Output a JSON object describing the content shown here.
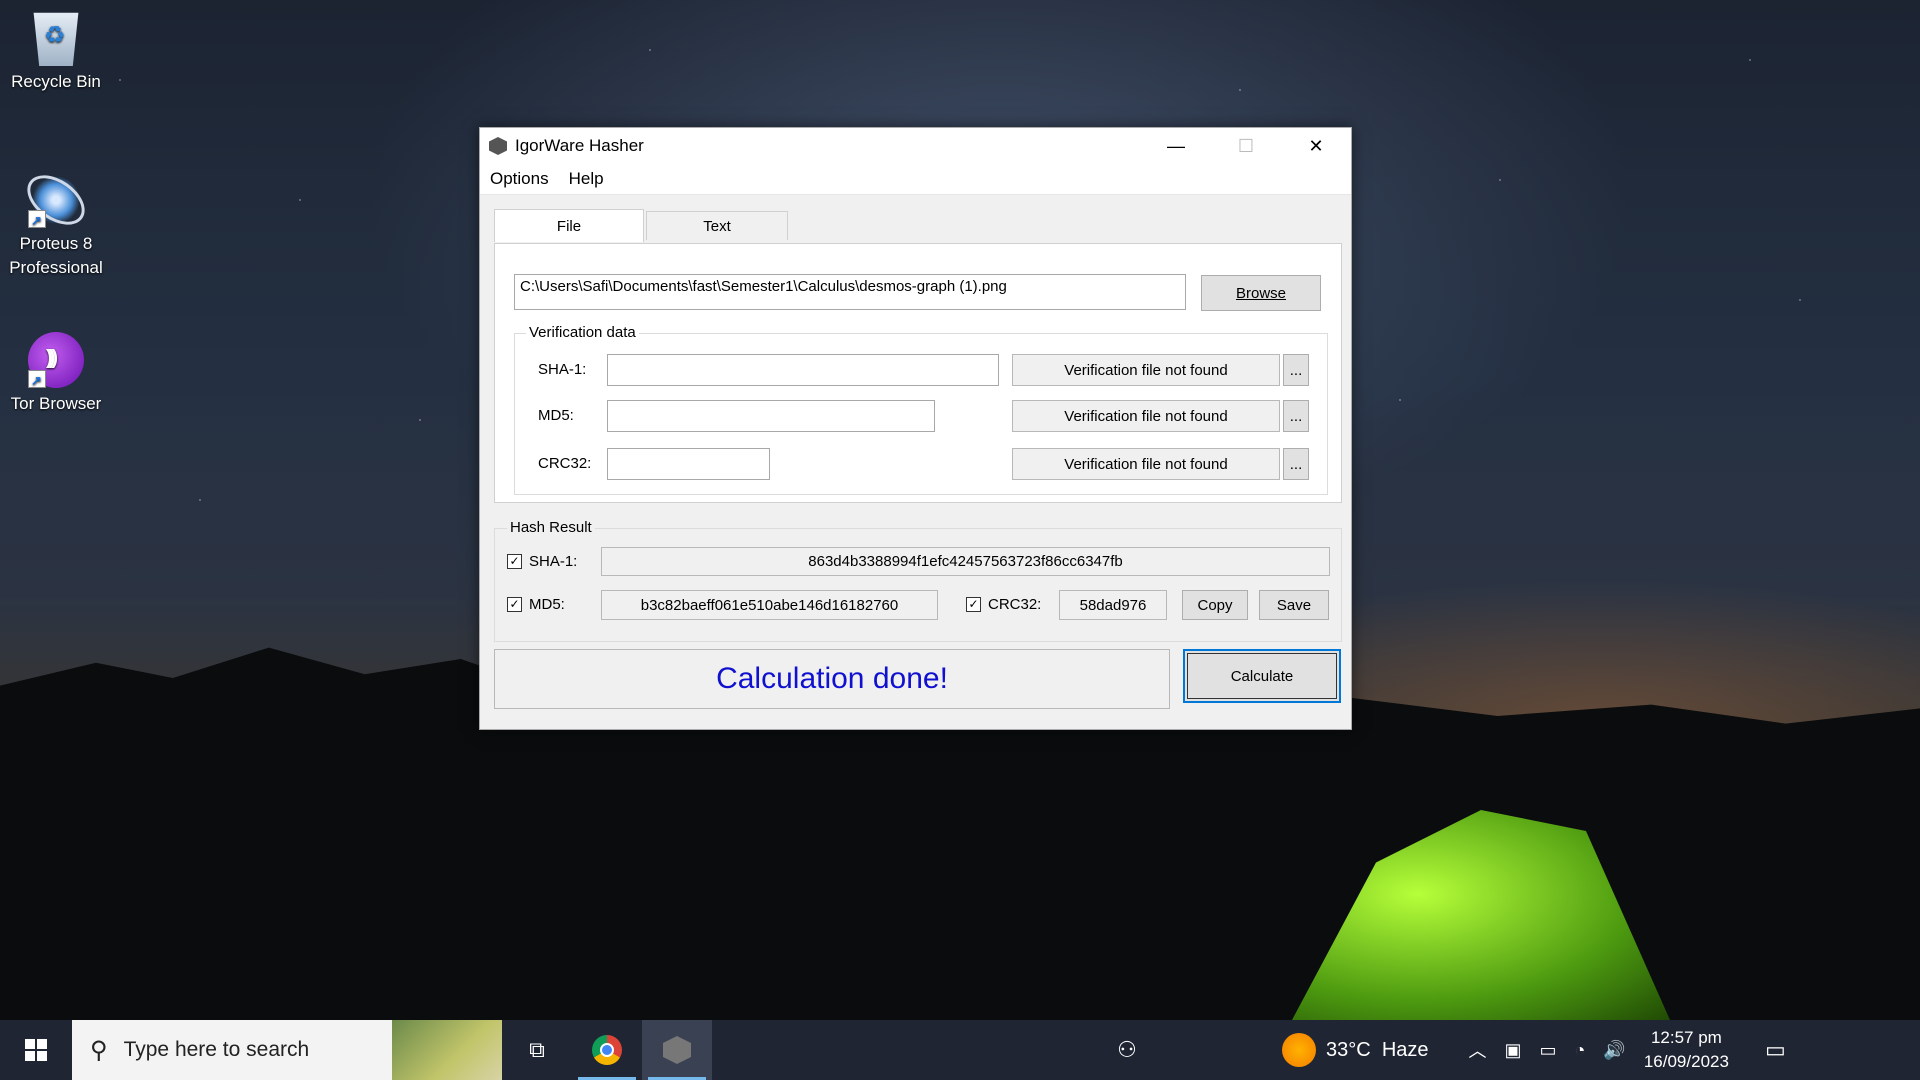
{
  "desktop": {
    "icons": [
      {
        "label": "Recycle Bin"
      },
      {
        "label": "Proteus 8 Professional"
      },
      {
        "label": "Tor Browser"
      }
    ]
  },
  "window": {
    "title": "IgorWare Hasher",
    "menu": [
      "Options",
      "Help"
    ],
    "tabs": [
      "File",
      "Text"
    ],
    "active_tab": "File",
    "file_path": "C:\\Users\\Safi\\Documents\\fast\\Semester1\\Calculus\\desmos-graph (1).png",
    "browse_label": "Browse",
    "verification": {
      "group_label": "Verification data",
      "rows": [
        {
          "label": "SHA-1:",
          "value": "",
          "status": "Verification file not found",
          "more": "..."
        },
        {
          "label": "MD5:",
          "value": "",
          "status": "Verification file not found",
          "more": "..."
        },
        {
          "label": "CRC32:",
          "value": "",
          "status": "Verification file not found",
          "more": "..."
        }
      ]
    },
    "hash_result": {
      "group_label": "Hash Result",
      "sha1_label": "SHA-1:",
      "sha1_value": "863d4b3388994f1efc42457563723f86cc6347fb",
      "sha1_checked": true,
      "md5_label": "MD5:",
      "md5_value": "b3c82baeff061e510abe146d16182760",
      "md5_checked": true,
      "crc32_label": "CRC32:",
      "crc32_value": "58dad976",
      "crc32_checked": true,
      "copy_label": "Copy",
      "save_label": "Save"
    },
    "status_text": "Calculation done!",
    "calculate_label": "Calculate",
    "status_color": "#1010d0"
  },
  "taskbar": {
    "search_placeholder": "Type here to search",
    "weather": {
      "temp": "33°C",
      "condition": "Haze"
    },
    "time": "12:57 pm",
    "date": "16/09/2023"
  }
}
